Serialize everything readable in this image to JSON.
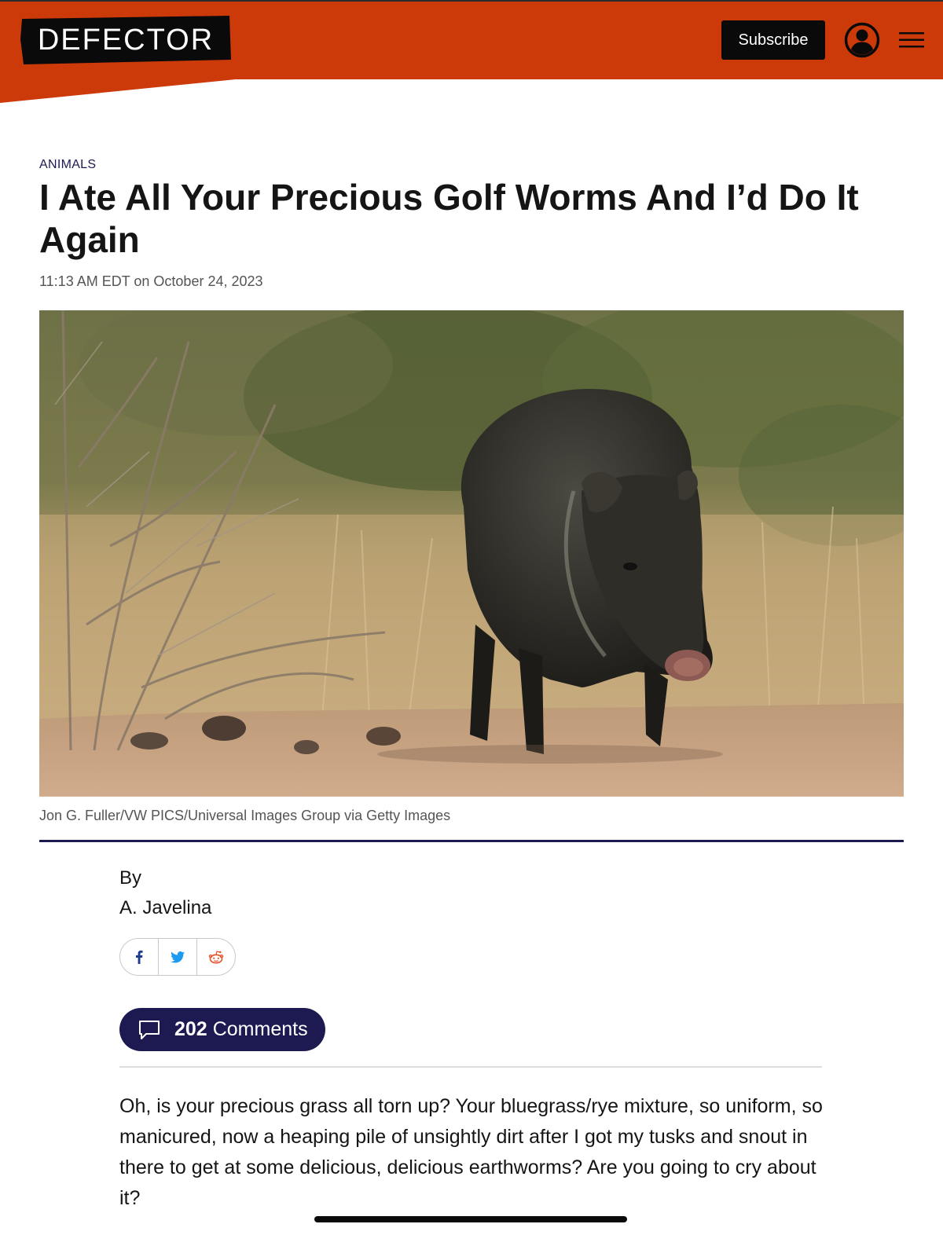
{
  "header": {
    "logo_text": "DEFECTOR",
    "subscribe_label": "Subscribe",
    "account_icon": "user-circle-icon",
    "menu_icon": "hamburger-menu-icon"
  },
  "article": {
    "category": "ANIMALS",
    "headline": "I Ate All Your Precious Golf Worms And I’d Do It Again",
    "dateline": "11:13 AM EDT on October 24, 2023",
    "image_credit": "Jon G. Fuller/VW PICS/Universal Images Group via Getty Images",
    "byline_prefix": "By",
    "author": "A. Javelina",
    "share": {
      "facebook_icon": "facebook-icon",
      "twitter_icon": "twitter-icon",
      "reddit_icon": "reddit-icon"
    },
    "comments": {
      "count": "202",
      "label": "Comments",
      "icon": "comment-bubble-icon"
    },
    "body_first_paragraph": "Oh, is your precious grass all torn up? Your bluegrass/rye mixture, so uniform, so manicured, now a heaping pile of unsightly dirt after I got my tusks and snout in there to get at some delicious, delicious earthworms? Are you going to cry about it?"
  },
  "colors": {
    "brand_orange": "#cc3a0a",
    "navy": "#1d1a52",
    "black": "#0a0a0a"
  }
}
